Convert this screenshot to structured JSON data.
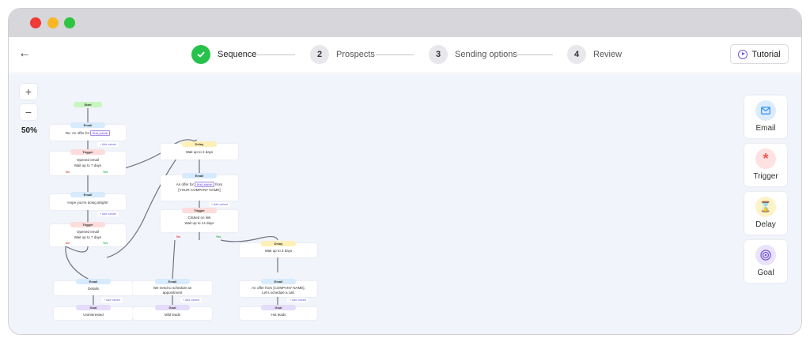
{
  "steps": [
    {
      "num": "",
      "label": "Sequence"
    },
    {
      "num": "2",
      "label": "Prospects"
    },
    {
      "num": "3",
      "label": "Sending options"
    },
    {
      "num": "4",
      "label": "Review"
    }
  ],
  "header": {
    "back_icon": "arrow-left-icon",
    "tutorial_label": "Tutorial"
  },
  "zoom": {
    "plus": "+",
    "minus": "−",
    "value": "50%"
  },
  "palette": [
    {
      "label": "Email",
      "icon": "mail-icon",
      "color": "#2d8ef5",
      "bg": "#dcecfd"
    },
    {
      "label": "Trigger",
      "icon": "asterisk-icon",
      "color": "#ef5a57",
      "bg": "#fde2e1"
    },
    {
      "label": "Delay",
      "icon": "hourglass-icon",
      "color": "#e0a400",
      "bg": "#fdf3c9"
    },
    {
      "label": "Goal",
      "icon": "target-icon",
      "color": "#7a5bd6",
      "bg": "#e9e3fb"
    }
  ],
  "flow": {
    "start": "Start",
    "email": "Email",
    "trigger": "Trigger",
    "delay": "Delay",
    "goal": "Goal",
    "add_variant": "+ Add variant",
    "no": "No",
    "yes": "Yes",
    "tag": "first_name",
    "e1_text": "Re: An offer for",
    "t1_line1": "Opened email",
    "t1_line2": "Wait up to 7 days",
    "e2_text": "Hope you're doing alright!",
    "t2_line1": "Opened email",
    "t2_line2": "Wait up to 7 days",
    "e3_text": "Details",
    "g1_text": "Uninterested",
    "d1_text": "Wait up to 2 days",
    "e4_pre": "An offer for",
    "e4_post": "from",
    "e4_line2": "[YOUR COMPANY NAME]",
    "t3_line1": "Clicked on link",
    "t3_line2": "Wait up to 14 days",
    "e5_line1": "We need to schedule an",
    "e5_line2": "appointment",
    "g2_text": "Mild leads",
    "d2_text": "Wait up to 3 days",
    "e6_line1": "An offer from [COMPANY NAME].",
    "e6_line2": "Let's schedule a call.",
    "g3_text": "Hot leads"
  }
}
